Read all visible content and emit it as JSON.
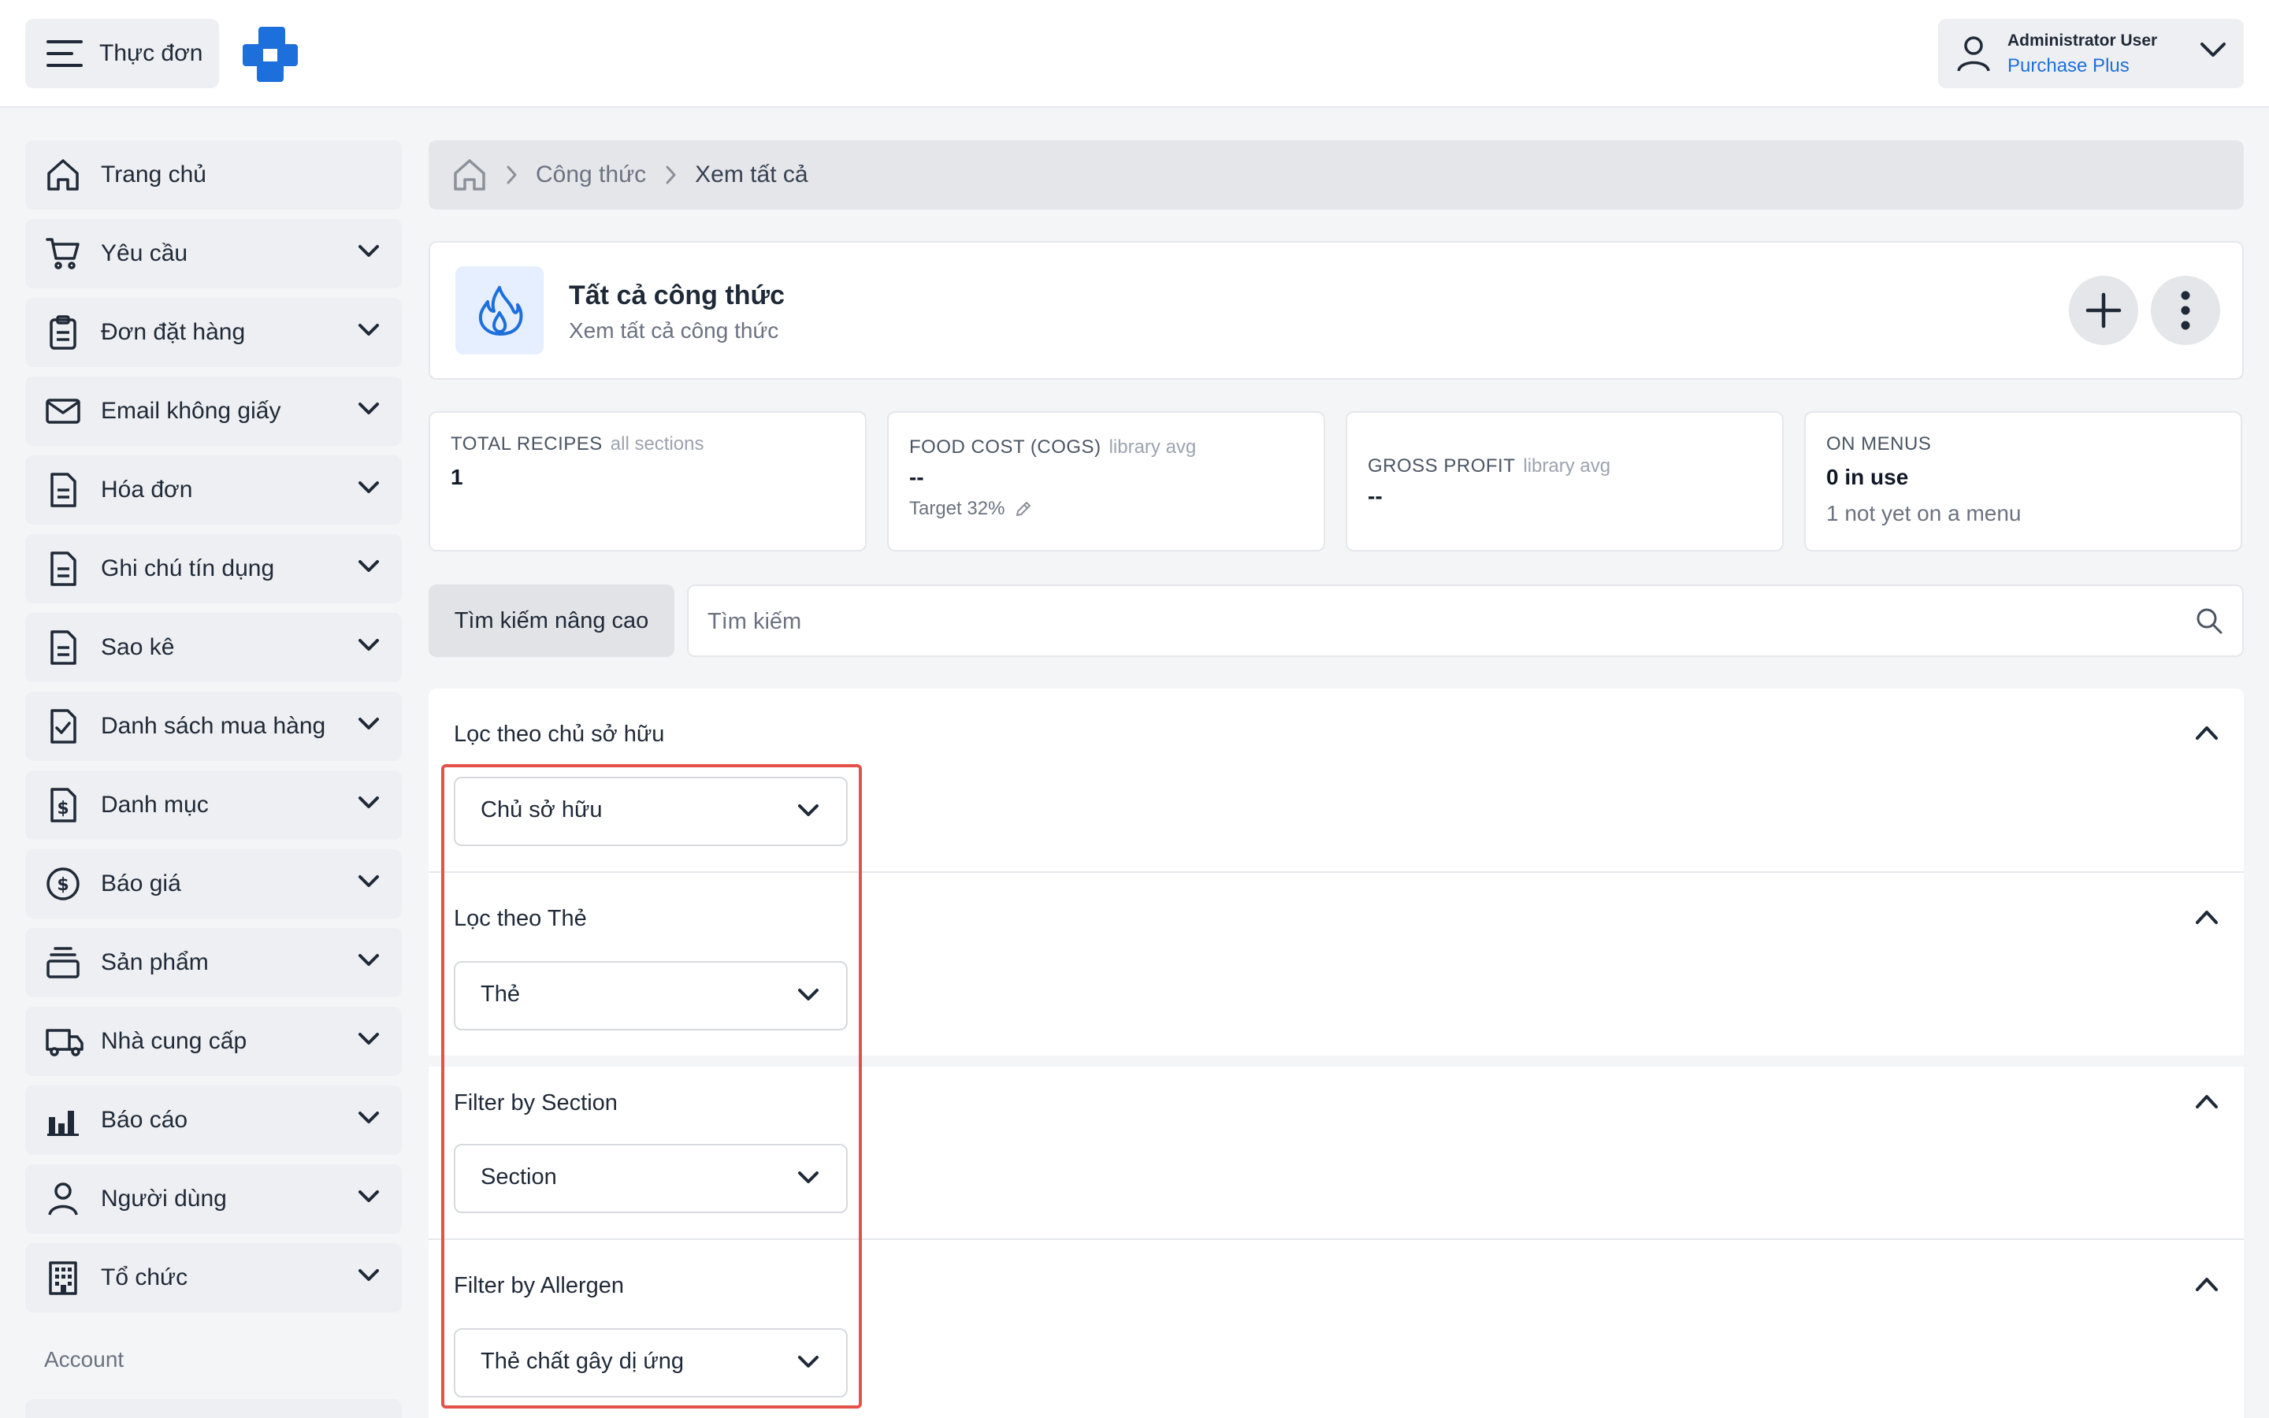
{
  "topbar": {
    "menu_label": "Thực đơn",
    "user_name": "Administrator User",
    "user_org": "Purchase Plus"
  },
  "colors": {
    "accent": "#1d6fdc",
    "highlight": "#e5524a",
    "surface": "#eeeff2"
  },
  "sidebar": {
    "items": [
      {
        "label": "Trang chủ",
        "icon": "home-icon"
      },
      {
        "label": "Yêu cầu",
        "icon": "cart-icon"
      },
      {
        "label": "Đơn đặt hàng",
        "icon": "clipboard-icon"
      },
      {
        "label": "Email không giấy",
        "icon": "mail-icon"
      },
      {
        "label": "Hóa đơn",
        "icon": "document-icon"
      },
      {
        "label": "Ghi chú tín dụng",
        "icon": "document-icon"
      },
      {
        "label": "Sao kê",
        "icon": "document-icon"
      },
      {
        "label": "Danh sách mua hàng",
        "icon": "checklist-icon"
      },
      {
        "label": "Danh mục",
        "icon": "dollar-document-icon"
      },
      {
        "label": "Báo giá",
        "icon": "dollar-circle-icon"
      },
      {
        "label": "Sản phẩm",
        "icon": "stack-icon"
      },
      {
        "label": "Nhà cung cấp",
        "icon": "truck-icon"
      },
      {
        "label": "Báo cáo",
        "icon": "bar-chart-icon"
      },
      {
        "label": "Người dùng",
        "icon": "user-icon"
      },
      {
        "label": "Tổ chức",
        "icon": "building-icon"
      }
    ],
    "section_label": "Account"
  },
  "breadcrumb": {
    "level1": "Công thức",
    "level2": "Xem tất cả"
  },
  "header": {
    "title": "Tất cả công thức",
    "subtitle": "Xem tất cả công thức"
  },
  "stats": {
    "total": {
      "label": "TOTAL RECIPES",
      "sub": "all sections",
      "value": "1"
    },
    "food_cost": {
      "label": "FOOD COST (COGS)",
      "sub": "library avg",
      "value": "--",
      "note": "Target 32%"
    },
    "gross_profit": {
      "label": "GROSS PROFIT",
      "sub": "library avg",
      "value": "--"
    },
    "on_menus": {
      "label": "ON MENUS",
      "value": "0 in use",
      "note": "1 not yet on a menu"
    }
  },
  "search": {
    "advanced_label": "Tìm kiếm nâng cao",
    "placeholder": "Tìm kiếm"
  },
  "filters": {
    "owner": {
      "title": "Lọc theo chủ sở hữu",
      "select": "Chủ sở hữu"
    },
    "tag": {
      "title": "Lọc theo Thẻ",
      "select": "Thẻ"
    },
    "section": {
      "title": "Filter by Section",
      "select": "Section"
    },
    "allergen": {
      "title": "Filter by Allergen",
      "select": "Thẻ chất gây dị ứng"
    }
  }
}
